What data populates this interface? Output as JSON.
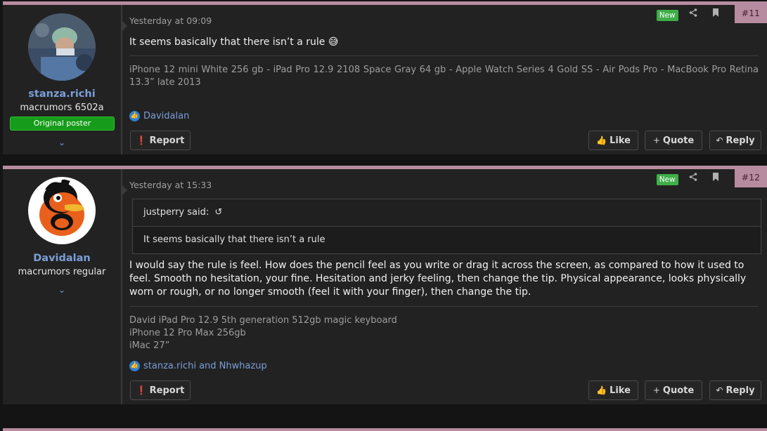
{
  "posts": [
    {
      "number": "#11",
      "new_label": "New",
      "date": "Yesterday at 09:09",
      "user": {
        "name": "stanza.richi",
        "title": "macrumors 6502a",
        "badge": "Original poster"
      },
      "message": "It seems basically that there isn’t a rule 😅",
      "signature": "iPhone 12 mini White 256 gb - iPad Pro 12.9 2108 Space Gray 64 gb - Apple Watch Series 4 Gold SS - Air Pods Pro - MacBook Pro Retina 13.3” late 2013",
      "reactions": "Davidalan",
      "buttons": {
        "report": "Report",
        "like": "Like",
        "quote": "Quote",
        "reply": "Reply"
      }
    },
    {
      "number": "#12",
      "new_label": "New",
      "date": "Yesterday at 15:33",
      "user": {
        "name": "Davidalan",
        "title": "macrumors regular"
      },
      "quote": {
        "author": "justperry said:",
        "text": "It seems basically that there isn’t a rule"
      },
      "message": "I would say the rule is feel. How does the pencil feel as you write or drag it across the screen, as compared to how it used to feel. Smooth no hesitation, your fine. Hesitation and jerky feeling, then change the tip. Physical appearance, looks physically worn or rough, or no longer smooth (feel it with your finger), then change the tip.",
      "signature_lines": [
        "David iPad Pro 12.9 5th generation 512gb magic keyboard",
        "iPhone 12 Pro Max 256gb",
        "iMac 27”"
      ],
      "reactions": "stanza.richi and Nhwhazup",
      "buttons": {
        "report": "Report",
        "like": "Like",
        "quote": "Quote",
        "reply": "Reply"
      }
    }
  ],
  "icons": {
    "share": "share-icon",
    "bookmark": "bookmark-icon",
    "like": "thumbs-up-icon",
    "report": "exclamation-circle-icon",
    "quote": "plus-icon",
    "reply": "reply-arrow-icon",
    "expand": "chevron-down-icon",
    "jump": "undo-arrow-icon"
  },
  "colors": {
    "accent": "#b88ca0",
    "username": "#7b9ed8",
    "new_badge": "#3fae49",
    "op_badge": "#169c1a",
    "background": "#222222"
  }
}
